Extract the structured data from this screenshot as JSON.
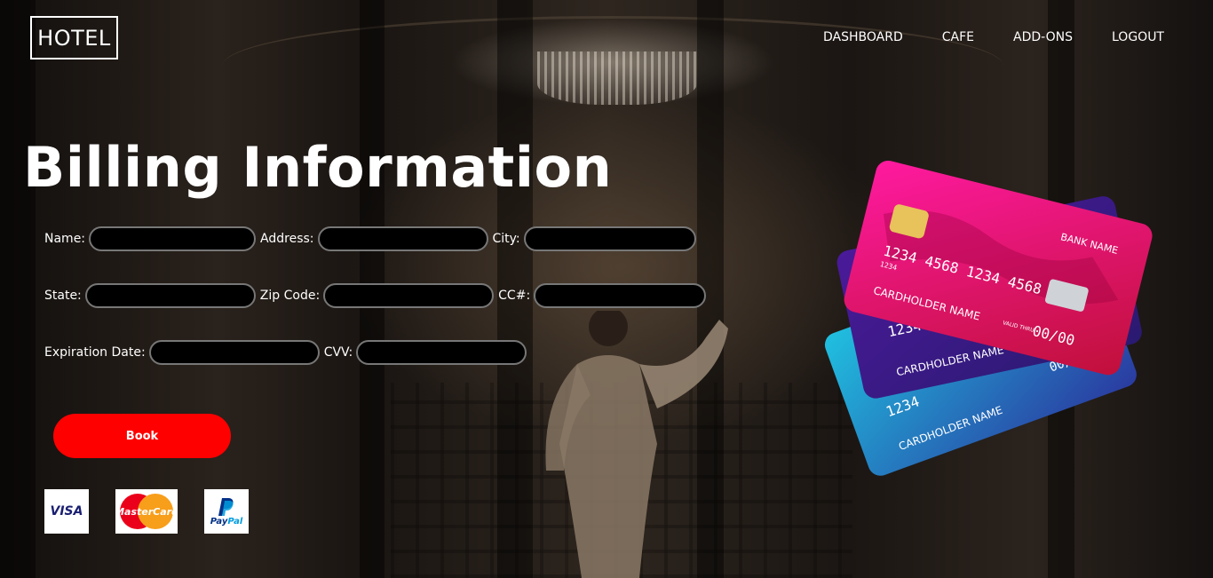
{
  "header": {
    "logo": "HOTEL",
    "nav": [
      "DASHBOARD",
      "CAFE",
      "ADD-ONS",
      "LOGOUT"
    ]
  },
  "page_title": "Billing Information",
  "form": {
    "name_label": "Name:",
    "address_label": "Address:",
    "city_label": "City:",
    "state_label": "State:",
    "zip_label": "Zip Code:",
    "cc_label": "CC#:",
    "exp_label": "Expiration Date:",
    "cvv_label": "CVV:",
    "name_value": "",
    "address_value": "",
    "city_value": "",
    "state_value": "",
    "zip_value": "",
    "cc_value": "",
    "exp_value": "",
    "cvv_value": ""
  },
  "book_label": "Book",
  "payment_logos": {
    "visa": "VISA",
    "mastercard": "MasterCard",
    "paypal_1": "Pay",
    "paypal_2": "Pal"
  },
  "cards_illustration": {
    "bank_name": "BANK NAME",
    "number_front": "1234  4568  1234  4568",
    "number_small": "1234",
    "holder": "CARDHOLDER NAME",
    "valid": "VALID THRU",
    "expiry": "00/00",
    "numbers_back": "1234"
  },
  "colors": {
    "accent": "#ff0000",
    "card_front": "#e0127a",
    "card_mid": "#5a1aa0",
    "card_back": "#1aa0c8"
  }
}
